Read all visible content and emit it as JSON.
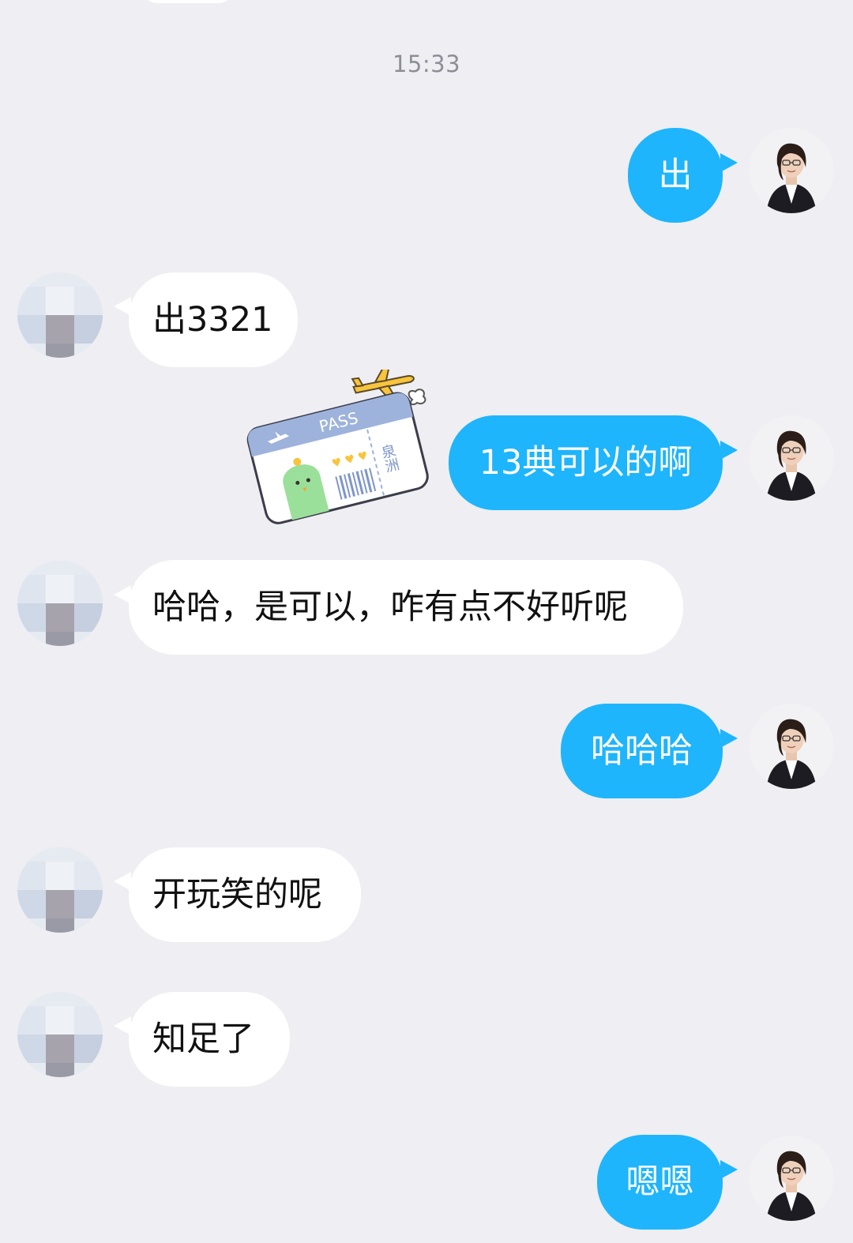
{
  "timestamp": "15:33",
  "messages": [
    {
      "side": "self",
      "text": "出"
    },
    {
      "side": "other",
      "text": "出3321"
    },
    {
      "side": "self",
      "text": "13典可以的啊",
      "sticker": {
        "text": "PASS",
        "caption": "泉洲"
      }
    },
    {
      "side": "other",
      "text": "哈哈，是可以，咋有点不好听呢"
    },
    {
      "side": "self",
      "text": "哈哈哈"
    },
    {
      "side": "other",
      "text": "开玩笑的呢"
    },
    {
      "side": "other",
      "text": "知足了"
    },
    {
      "side": "self",
      "text": "嗯嗯"
    }
  ],
  "colors": {
    "background": "#eeeef3",
    "self_bubble": "#1eb5fc",
    "other_bubble": "#ffffff",
    "timestamp": "#8e8e96"
  },
  "icons": {
    "self_avatar": "woman-avatar-icon",
    "other_avatar": "blurred-avatar-icon",
    "sticker": "boarding-pass-sticker"
  }
}
